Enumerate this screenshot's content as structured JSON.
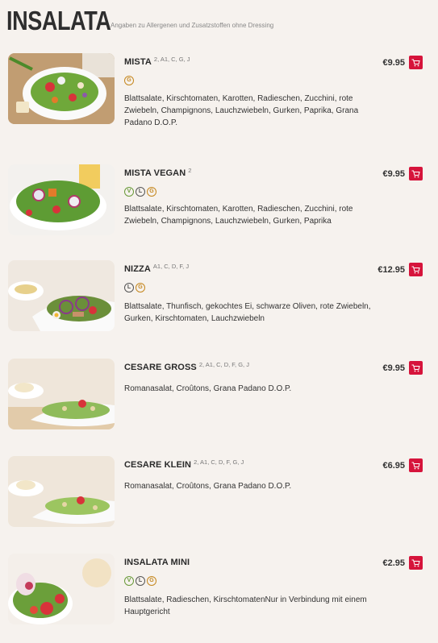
{
  "header": {
    "title": "INSALATA",
    "subtitle": "Angaben zu Allergenen und Zusatzstoffen ohne Dressing"
  },
  "icons": {
    "cart": "shopping-cart-icon"
  },
  "colors": {
    "background": "#f6f2ee",
    "cart_button": "#d6143b",
    "vegan_badge": "#6a9a3a",
    "lactose_badge": "#555555",
    "gluten_badge": "#c5871e"
  },
  "items": [
    {
      "name": "MISTA",
      "allergens": "2, A1, C, G, J",
      "badges": [
        "G"
      ],
      "description": "Blattsalate, Kirschtomaten, Karotten, Radieschen, Zucchini, rote Zwiebeln, Champignons, Lauchzwiebeln, Gurken, Paprika, Grana Padano D.O.P.",
      "price": "€9.95"
    },
    {
      "name": "MISTA VEGAN",
      "allergens": "2",
      "badges": [
        "V",
        "L",
        "G"
      ],
      "description": "Blattsalate, Kirschtomaten, Karotten, Radieschen, Zucchini, rote Zwiebeln, Champignons, Lauchzwiebeln, Gurken, Paprika",
      "price": "€9.95"
    },
    {
      "name": "NIZZA",
      "allergens": "A1, C, D, F, J",
      "badges": [
        "L",
        "G"
      ],
      "description": "Blattsalate, Thunfisch, gekochtes Ei, schwarze Oliven, rote Zwiebeln, Gurken, Kirschtomaten, Lauchzwiebeln",
      "price": "€12.95"
    },
    {
      "name": "CESARE GROSS",
      "allergens": "2, A1, C, D, F, G, J",
      "badges": [],
      "description": "Romanasalat, Croûtons, Grana Padano D.O.P.",
      "price": "€9.95"
    },
    {
      "name": "CESARE KLEIN",
      "allergens": "2, A1, C, D, F, G, J",
      "badges": [],
      "description": "Romanasalat, Croûtons, Grana Padano D.O.P.",
      "price": "€6.95"
    },
    {
      "name": "INSALATA MINI",
      "allergens": "",
      "badges": [
        "V",
        "L",
        "G"
      ],
      "description": "Blattsalate, Radieschen, KirschtomatenNur in Verbindung mit einem Hauptgericht",
      "price": "€2.95"
    }
  ]
}
